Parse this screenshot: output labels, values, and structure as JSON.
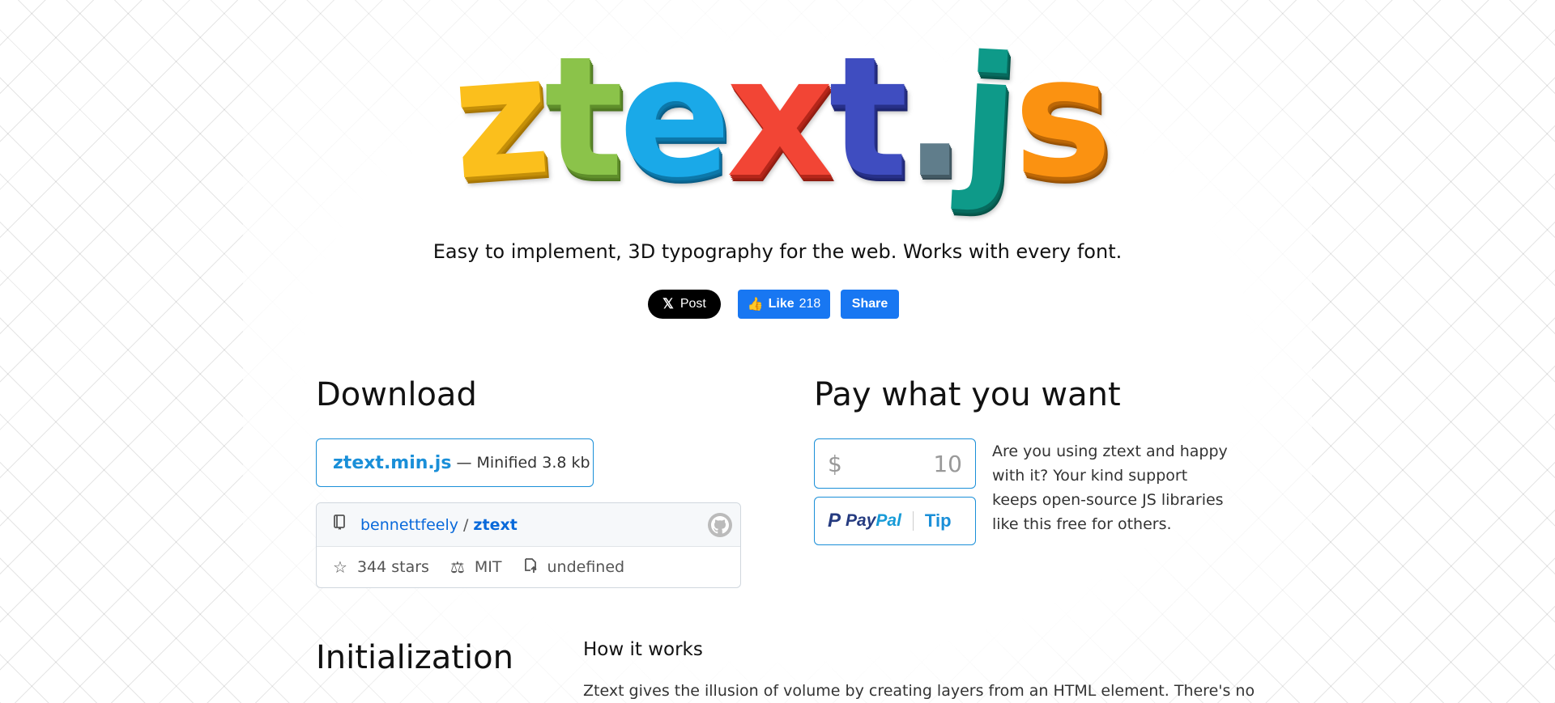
{
  "logo": {
    "letters": [
      "z",
      "t",
      "e",
      "x",
      "t",
      ".",
      "j",
      "s"
    ]
  },
  "tagline": "Easy to implement, 3D typography for the web. Works with every font.",
  "social": {
    "x_post_label": "Post",
    "like_label": "Like",
    "like_count": "218",
    "share_label": "Share"
  },
  "download": {
    "heading": "Download",
    "file_name": "ztext.min.js",
    "file_desc": "— Minified 3.8 kb"
  },
  "github": {
    "owner": "bennettfeely",
    "separator": "/",
    "repo": "ztext",
    "stars": "344 stars",
    "license": "MIT",
    "extra": "undefined"
  },
  "pay": {
    "heading": "Pay what you want",
    "currency": "$",
    "amount": "10",
    "paypal_pay": "Pay",
    "paypal_pal": "Pal",
    "tip_label": "Tip",
    "text": "Are you using ztext and happy with it? Your kind support keeps open-source JS libraries like this free for others."
  },
  "init": {
    "heading": "Initialization",
    "how_title": "How it works",
    "how_text": "Ztext gives the illusion of volume by creating layers from an HTML element. There's no"
  },
  "colors": {
    "accent": "#1a8fd8",
    "facebook": "#1877f2",
    "github_link": "#0969da"
  }
}
